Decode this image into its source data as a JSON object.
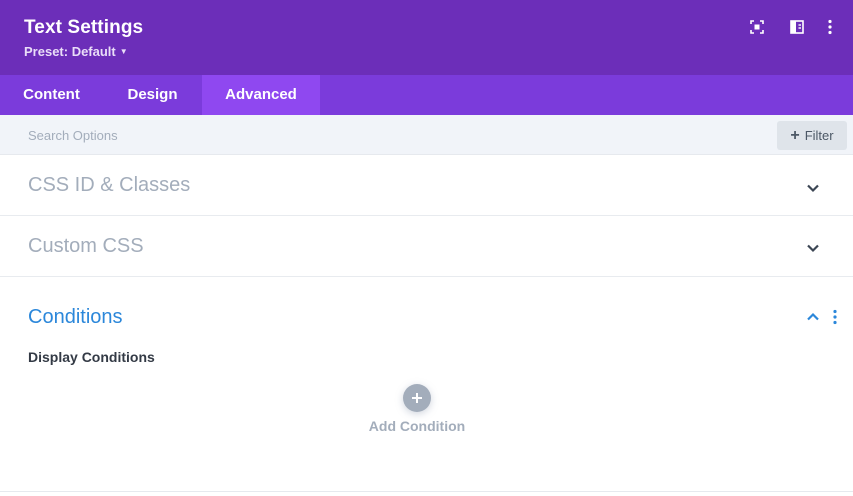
{
  "header": {
    "title": "Text Settings",
    "preset_label": "Preset: Default",
    "icons": [
      "focus-frame-icon",
      "split-view-icon",
      "more-vertical-icon"
    ],
    "background_color": "#6c2eb9"
  },
  "tabs": [
    {
      "label": "Content",
      "active": false
    },
    {
      "label": "Design",
      "active": false
    },
    {
      "label": "Advanced",
      "active": true
    }
  ],
  "search": {
    "placeholder": "Search Options",
    "value": "",
    "filter_label": "Filter"
  },
  "sections": [
    {
      "title": "CSS ID & Classes",
      "expanded": false
    },
    {
      "title": "Custom CSS",
      "expanded": false
    },
    {
      "title": "Conditions",
      "expanded": true
    }
  ],
  "conditions": {
    "display_label": "Display Conditions",
    "add_label": "Add Condition"
  },
  "colors": {
    "accent": "#2b87da",
    "tab_bar": "#7b3bdb",
    "tab_active": "#8f48f0",
    "muted": "#a3adbb"
  }
}
